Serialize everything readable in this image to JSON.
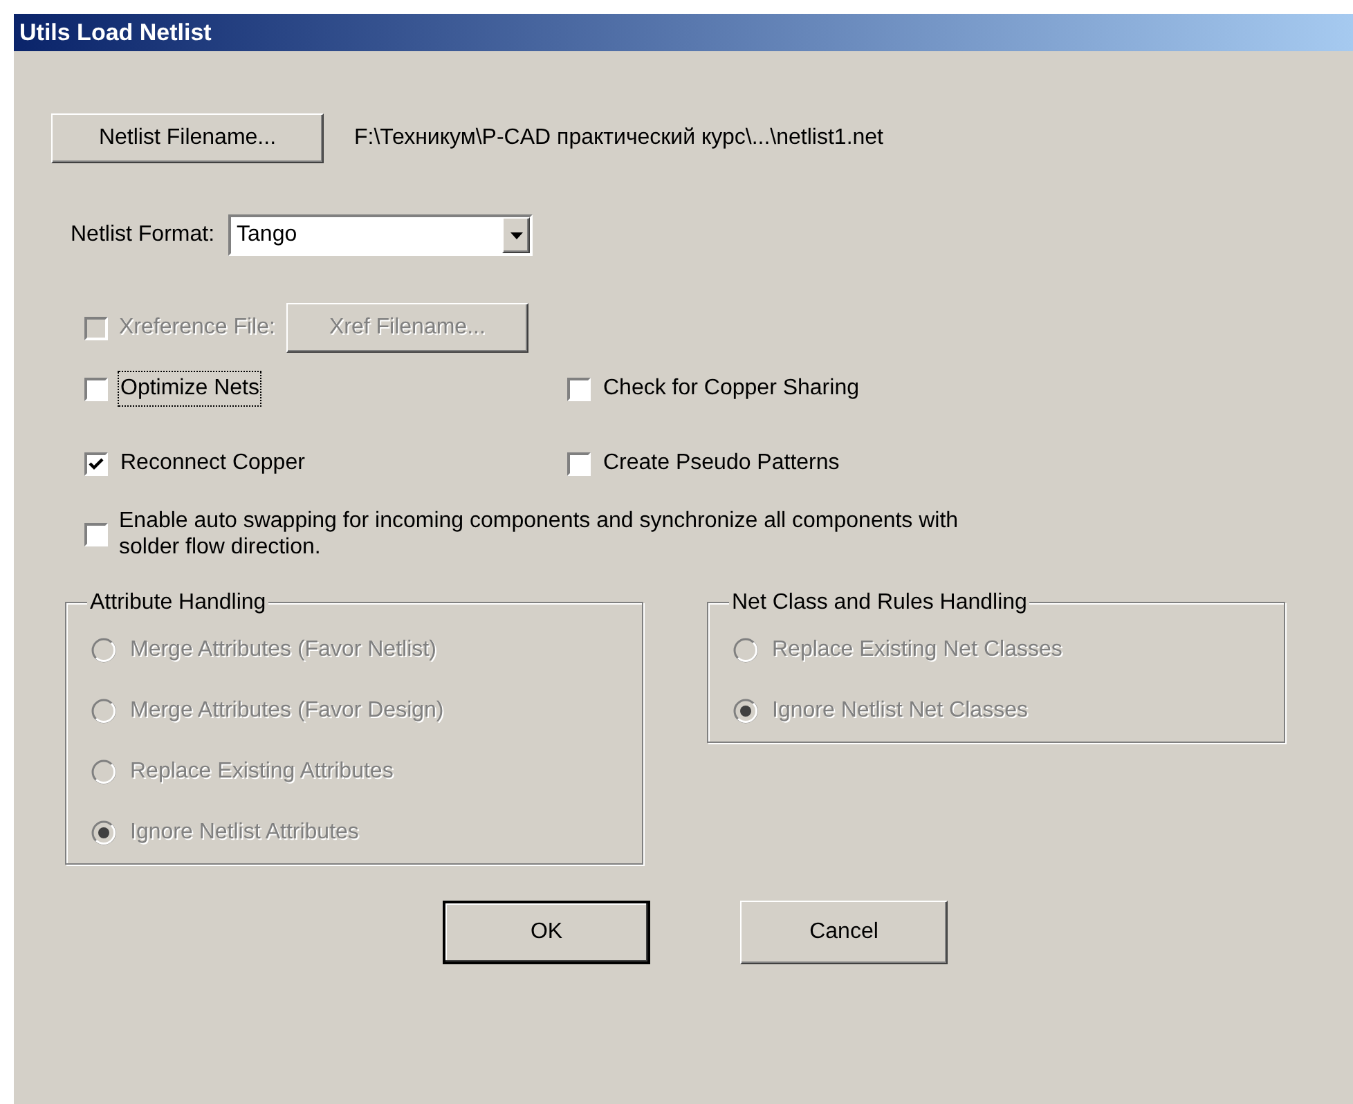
{
  "window": {
    "title": "Utils Load Netlist"
  },
  "filename_button": {
    "label": "Netlist Filename..."
  },
  "filename_path": "F:\\Техникум\\P-CAD практический курс\\...\\netlist1.net",
  "format": {
    "label": "Netlist Format:",
    "value": "Tango"
  },
  "xref": {
    "label": "Xreference File:",
    "checked": false,
    "disabled": true,
    "button": {
      "label": "Xref Filename...",
      "disabled": true
    }
  },
  "options": [
    {
      "label": "Optimize Nets",
      "checked": false,
      "focused": true
    },
    {
      "label": "Check for Copper Sharing",
      "checked": false,
      "focused": false
    },
    {
      "label": "Reconnect Copper",
      "checked": true,
      "focused": false
    },
    {
      "label": "Create Pseudo Patterns",
      "checked": false,
      "focused": false
    }
  ],
  "auto_swap": {
    "label": "Enable auto swapping for incoming components and synchronize all components with solder flow direction.",
    "checked": false
  },
  "groups": [
    {
      "title": "Attribute Handling",
      "options": [
        {
          "label": "Merge Attributes (Favor Netlist)",
          "selected": false,
          "disabled": true
        },
        {
          "label": "Merge Attributes (Favor Design)",
          "selected": false,
          "disabled": true
        },
        {
          "label": "Replace Existing Attributes",
          "selected": false,
          "disabled": true
        },
        {
          "label": "Ignore Netlist Attributes",
          "selected": true,
          "disabled": true
        }
      ]
    },
    {
      "title": "Net Class and Rules Handling",
      "options": [
        {
          "label": "Replace Existing Net Classes",
          "selected": false,
          "disabled": true
        },
        {
          "label": "Ignore Netlist Net Classes",
          "selected": true,
          "disabled": true
        }
      ]
    }
  ],
  "buttons": [
    {
      "label": "OK",
      "default": true
    },
    {
      "label": "Cancel",
      "default": false
    }
  ]
}
